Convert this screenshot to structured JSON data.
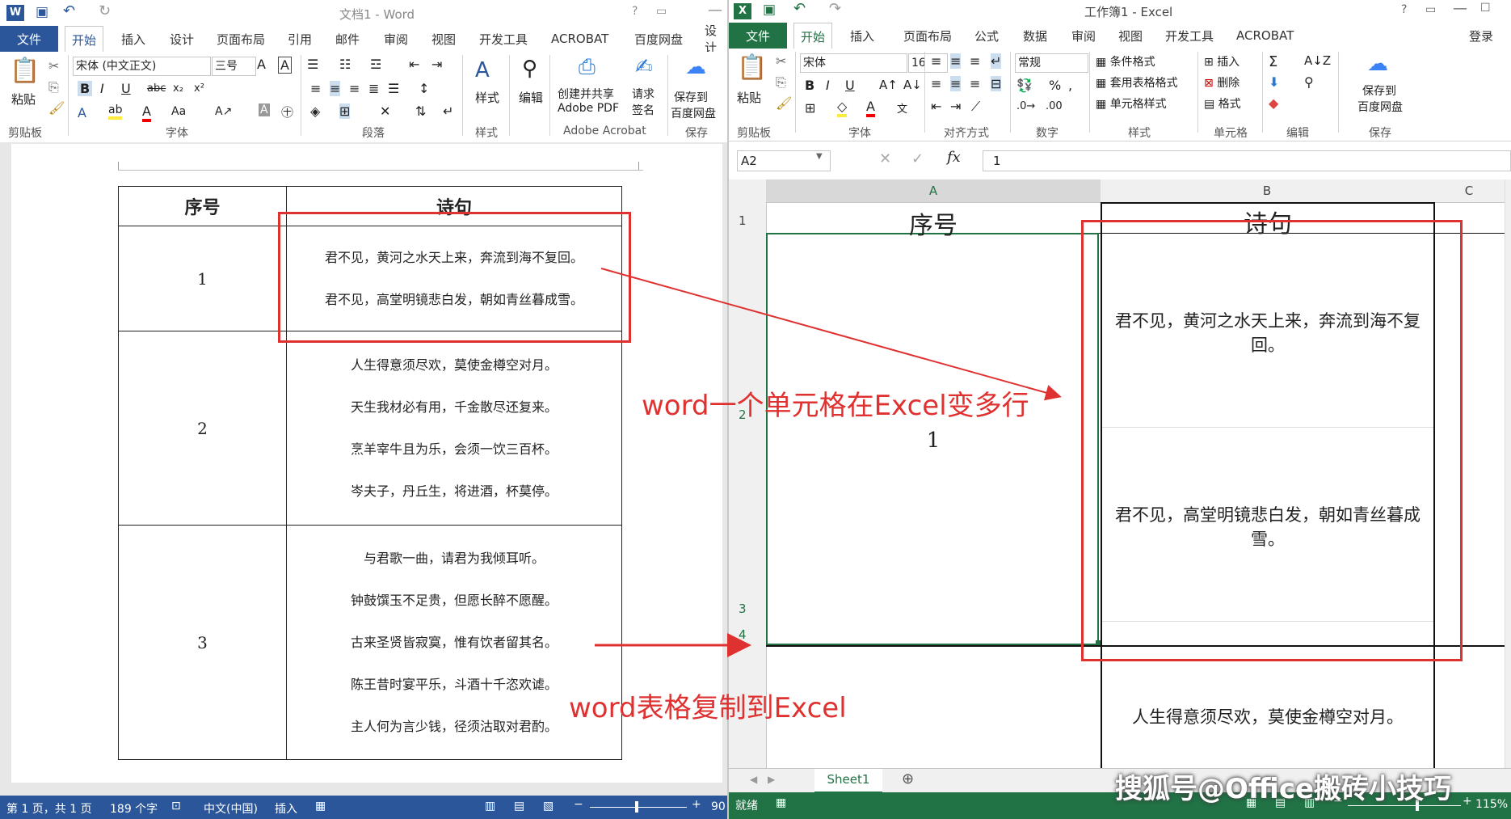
{
  "word": {
    "title": "文档1 - Word",
    "tabs": [
      "文件",
      "开始",
      "插入",
      "设计",
      "页面布局",
      "引用",
      "邮件",
      "审阅",
      "视图",
      "开发工具",
      "ACROBAT",
      "百度网盘",
      "设计"
    ],
    "ribbon": {
      "paste": "粘贴",
      "font_name": "宋体 (中文正文)",
      "font_size": "三号",
      "style_label": "样式",
      "edit_label": "编辑",
      "create_pdf": "创建并共享",
      "create_pdf2": "Adobe PDF",
      "request_sign": "请求",
      "request_sign2": "签名",
      "save_baidu": "保存到",
      "save_baidu2": "百度网盘",
      "groups": [
        "剪贴板",
        "字体",
        "段落",
        "样式",
        "Adobe Acrobat",
        "保存"
      ]
    },
    "table": {
      "headers": [
        "序号",
        "诗句"
      ],
      "rows": [
        {
          "idx": "1",
          "lines": [
            "君不见，黄河之水天上来，奔流到海不复回。",
            "君不见，高堂明镜悲白发，朝如青丝暮成雪。"
          ]
        },
        {
          "idx": "2",
          "lines": [
            "人生得意须尽欢，莫使金樽空对月。",
            "天生我材必有用，千金散尽还复来。",
            "烹羊宰牛且为乐，会须一饮三百杯。",
            "岑夫子，丹丘生，将进酒，杯莫停。"
          ]
        },
        {
          "idx": "3",
          "lines": [
            "与君歌一曲，请君为我倾耳听。",
            "钟鼓馔玉不足贵，但愿长醉不愿醒。",
            "古来圣贤皆寂寞，惟有饮者留其名。",
            "陈王昔时宴平乐，斗酒十千恣欢谑。",
            "主人何为言少钱，径须沽取对君酌。"
          ]
        }
      ]
    },
    "status": {
      "page": "第 1 页，共 1 页",
      "words": "189 个字",
      "lang": "中文(中国)",
      "mode": "插入",
      "zoom": "90"
    }
  },
  "excel": {
    "title": "工作簿1 - Excel",
    "login": "登录",
    "tabs": [
      "文件",
      "开始",
      "插入",
      "页面布局",
      "公式",
      "数据",
      "审阅",
      "视图",
      "开发工具",
      "ACROBAT"
    ],
    "ribbon": {
      "paste": "粘贴",
      "font_name": "宋体",
      "font_size": "16",
      "number_format": "常规",
      "cond_format": "条件格式",
      "table_format": "套用表格格式",
      "cell_style": "单元格样式",
      "insert": "插入",
      "delete": "删除",
      "format": "格式",
      "save_baidu": "保存到",
      "save_baidu2": "百度网盘",
      "groups": [
        "剪贴板",
        "字体",
        "对齐方式",
        "数字",
        "样式",
        "单元格",
        "编辑",
        "保存"
      ]
    },
    "name_box": "A2",
    "formula_value": "1",
    "columns": [
      "A",
      "B",
      "C"
    ],
    "rows": [
      "1",
      "2",
      "3",
      "4"
    ],
    "cells": {
      "a1": "序号",
      "b1": "诗句",
      "a2": "1",
      "b2": "君不见，黄河之水天上来，奔流到海不复回。",
      "b3": "君不见，高堂明镜悲白发，朝如青丝暮成雪。",
      "b5": "人生得意须尽欢，莫使金樽空对月。"
    },
    "sheet_tab": "Sheet1",
    "status": {
      "ready": "就绪",
      "zoom": "115%"
    }
  },
  "annotations": {
    "label1": "word一个单元格在Excel变多行",
    "label2": "word表格复制到Excel",
    "color": "#e03131"
  },
  "watermark": "搜狐号@Office搬砖小技巧",
  "colors": {
    "word_blue": "#2b579a",
    "excel_green": "#217346"
  }
}
